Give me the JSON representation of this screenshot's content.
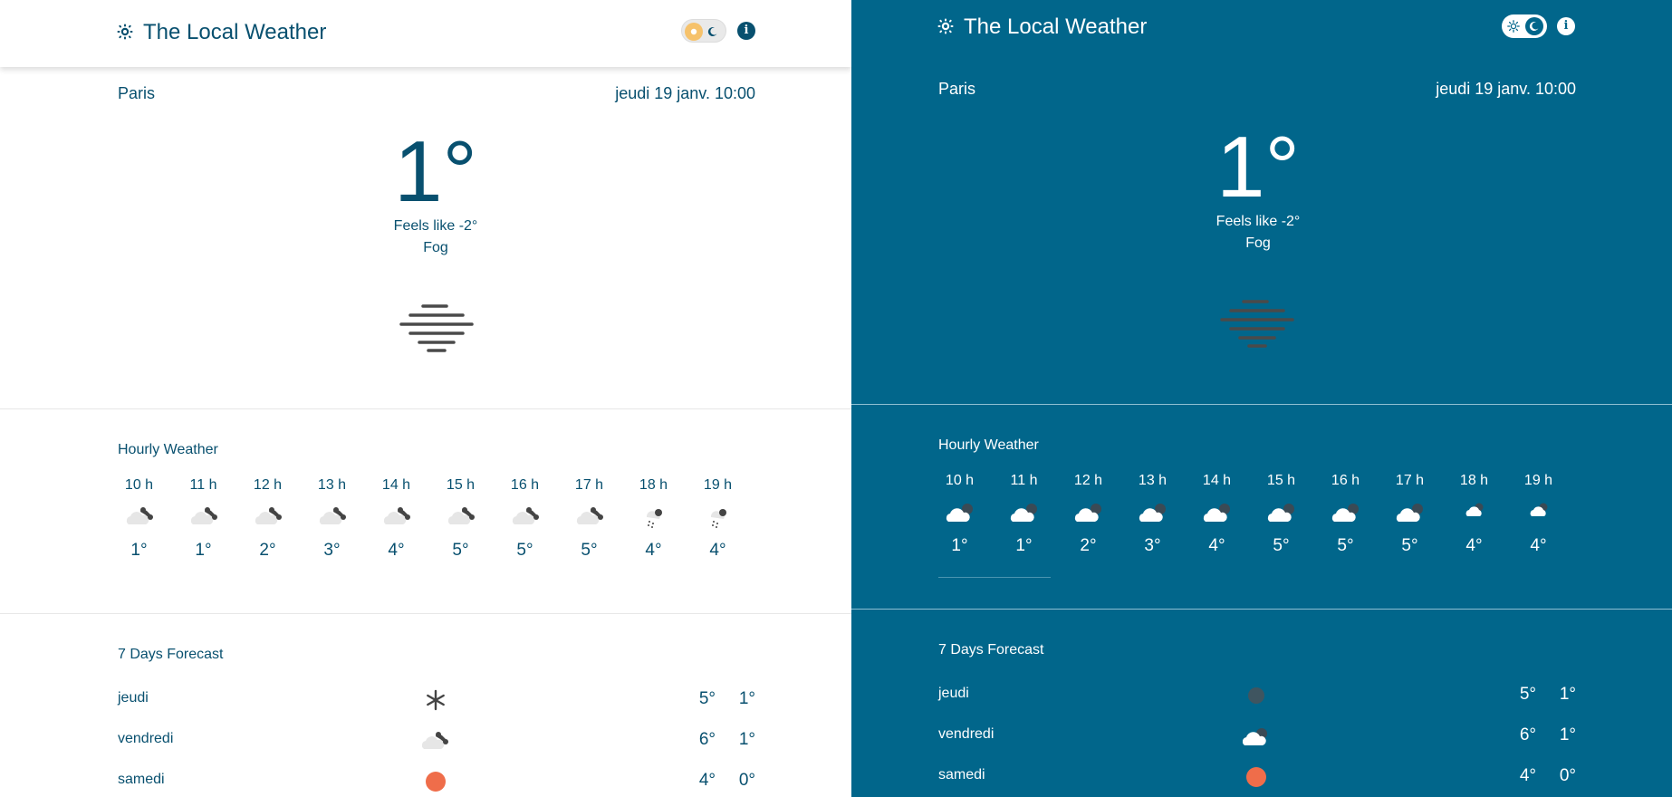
{
  "app": {
    "title": "The Local Weather"
  },
  "current": {
    "city": "Paris",
    "datetime": "jeudi 19 janv. 10:00",
    "temperature": "1°",
    "feels_like": "Feels like -2°",
    "condition": "Fog",
    "condition_icon": "fog-icon"
  },
  "hourly": {
    "title": "Hourly Weather",
    "items": [
      {
        "hour": "10 h",
        "temp": "1°",
        "icon": "cloudy-night-icon"
      },
      {
        "hour": "11 h",
        "temp": "1°",
        "icon": "cloudy-night-icon"
      },
      {
        "hour": "12 h",
        "temp": "2°",
        "icon": "cloudy-night-icon"
      },
      {
        "hour": "13 h",
        "temp": "3°",
        "icon": "cloudy-night-icon"
      },
      {
        "hour": "14 h",
        "temp": "4°",
        "icon": "cloudy-night-icon"
      },
      {
        "hour": "15 h",
        "temp": "5°",
        "icon": "cloudy-night-icon"
      },
      {
        "hour": "16 h",
        "temp": "5°",
        "icon": "cloudy-night-icon"
      },
      {
        "hour": "17 h",
        "temp": "5°",
        "icon": "cloudy-night-icon"
      },
      {
        "hour": "18 h",
        "temp": "4°",
        "icon": "snow-night-icon"
      },
      {
        "hour": "19 h",
        "temp": "4°",
        "icon": "snow-night-icon"
      }
    ]
  },
  "forecast": {
    "title": "7 Days Forecast",
    "days": [
      {
        "day": "jeudi",
        "max": "5°",
        "min": "1°",
        "icon": "snowflake-icon"
      },
      {
        "day": "vendredi",
        "max": "6°",
        "min": "1°",
        "icon": "cloudy-night-icon"
      },
      {
        "day": "samedi",
        "max": "4°",
        "min": "0°",
        "icon": "sun-icon"
      }
    ]
  },
  "colors": {
    "light_text": "#08506f",
    "dark_background": "#01668b",
    "sun": "#ef6d4a"
  }
}
